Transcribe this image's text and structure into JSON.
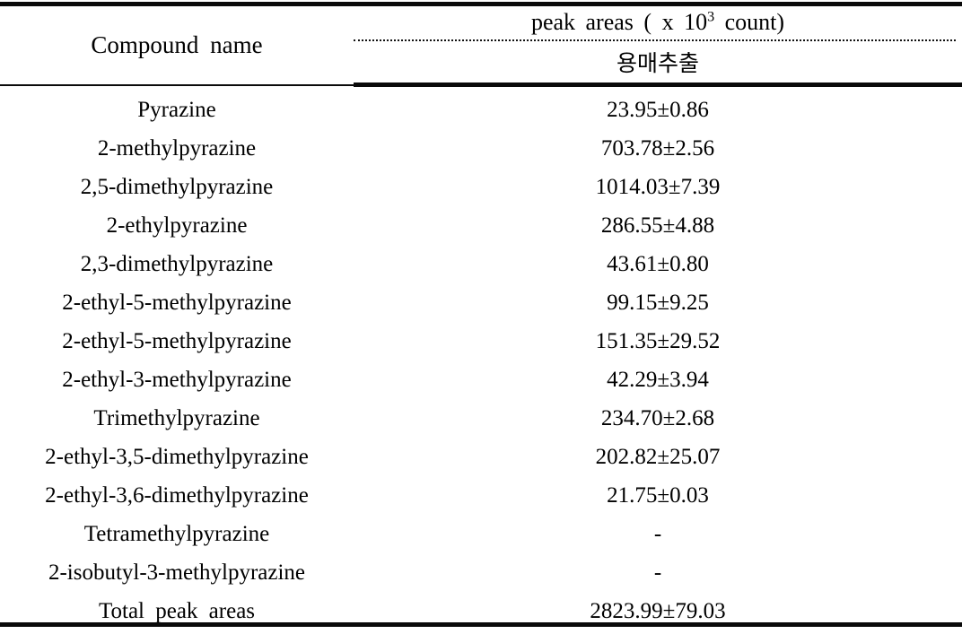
{
  "table": {
    "columns": {
      "compound_header": "Compound name",
      "peak_areas_header_prefix": "peak areas ( x 10",
      "peak_areas_header_sup": "3",
      "peak_areas_header_suffix": " count)",
      "peak_areas_subheader": "용매추출"
    },
    "rows": [
      {
        "name": "Pyrazine",
        "value": "23.95±0.86"
      },
      {
        "name": "2-methylpyrazine",
        "value": "703.78±2.56"
      },
      {
        "name": "2,5-dimethylpyrazine",
        "value": "1014.03±7.39"
      },
      {
        "name": "2-ethylpyrazine",
        "value": "286.55±4.88"
      },
      {
        "name": "2,3-dimethylpyrazine",
        "value": "43.61±0.80"
      },
      {
        "name": "2-ethyl-5-methylpyrazine",
        "value": "99.15±9.25"
      },
      {
        "name": "2-ethyl-5-methylpyrazine",
        "value": "151.35±29.52"
      },
      {
        "name": "2-ethyl-3-methylpyrazine",
        "value": "42.29±3.94"
      },
      {
        "name": "Trimethylpyrazine",
        "value": "234.70±2.68"
      },
      {
        "name": "2-ethyl-3,5-dimethylpyrazine",
        "value": "202.82±25.07"
      },
      {
        "name": "2-ethyl-3,6-dimethylpyrazine",
        "value": "21.75±0.03"
      },
      {
        "name": "Tetramethylpyrazine",
        "value": "-"
      },
      {
        "name": "2-isobutyl-3-methylpyrazine",
        "value": "-"
      },
      {
        "name": "Total peak areas",
        "value": "2823.99±79.03"
      }
    ]
  },
  "colors": {
    "text": "#000000",
    "rule": "#0a0a0a",
    "background": "#ffffff"
  }
}
